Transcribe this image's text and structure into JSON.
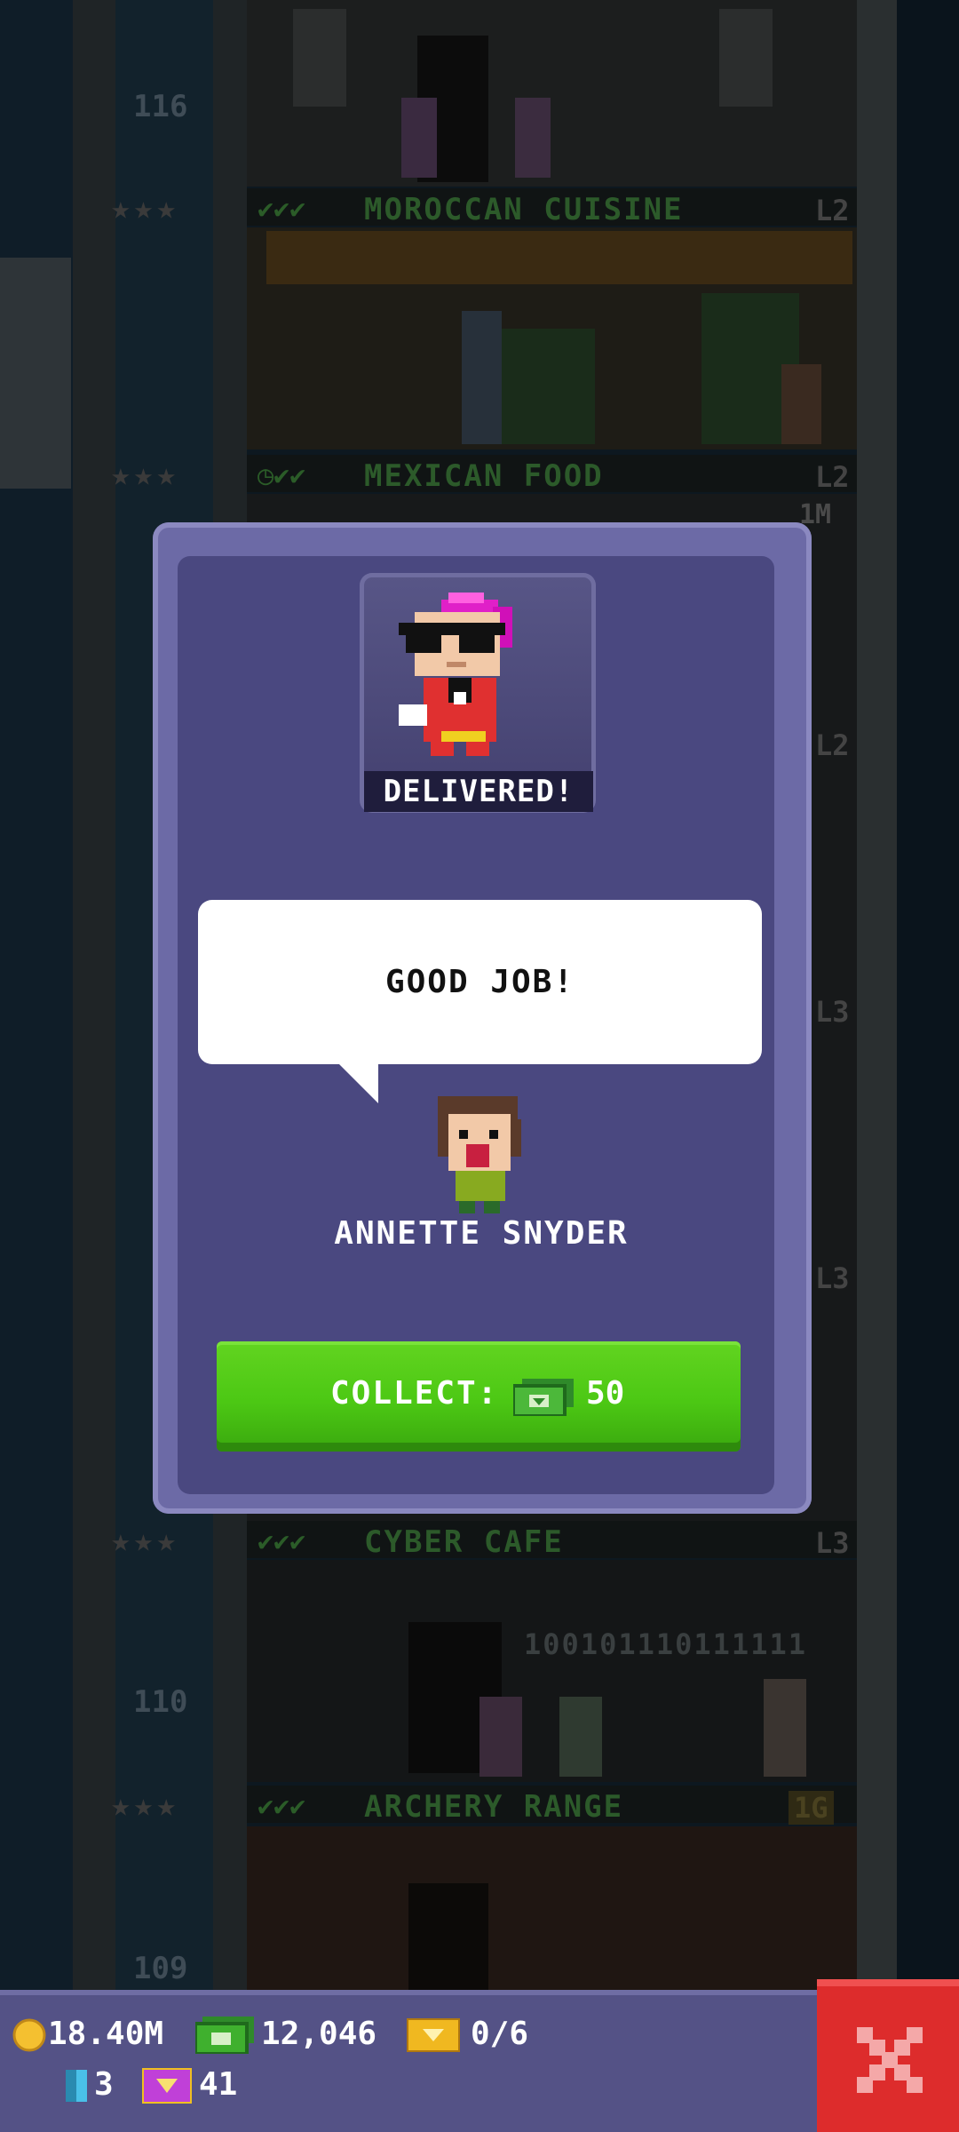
{
  "background": {
    "floors": [
      {
        "number": "116",
        "name": "",
        "level": "",
        "checks": ""
      },
      {
        "number": "",
        "name": "MOROCCAN CUISINE",
        "level": "L2",
        "checks": "✔✔✔"
      },
      {
        "number": "",
        "name": "MEXICAN FOOD",
        "level": "L2",
        "checks": "◷✔✔"
      },
      {
        "number": "",
        "name": "CYBER CAFE",
        "level": "L3",
        "checks": "✔✔✔"
      },
      {
        "number": "110",
        "name": "ARCHERY RANGE",
        "level": "1G",
        "checks": "✔✔✔"
      },
      {
        "number": "109",
        "name": "",
        "level": "",
        "checks": ""
      }
    ],
    "price_tag": "1M",
    "binary_text": "100101110111111",
    "side_levels": [
      "L2",
      "L3",
      "L3"
    ]
  },
  "dialog": {
    "status_label": "DELIVERED!",
    "speech": "GOOD JOB!",
    "npc_name": "ANNETTE SNYDER",
    "collect_label": "COLLECT:",
    "collect_value": "50",
    "collect_icon": "cash-icon"
  },
  "status_bar": {
    "coins": "18.40M",
    "bux": "12,046",
    "tickets": "0/6",
    "keys": "3",
    "gifts": "41",
    "close_icon": "close-icon"
  },
  "colors": {
    "dialog_frame": "#6c6aa6",
    "dialog_inner": "#4a4880",
    "collect_green": "#4cc814",
    "close_red": "#dd2c2c",
    "status_bar": "#545286"
  }
}
